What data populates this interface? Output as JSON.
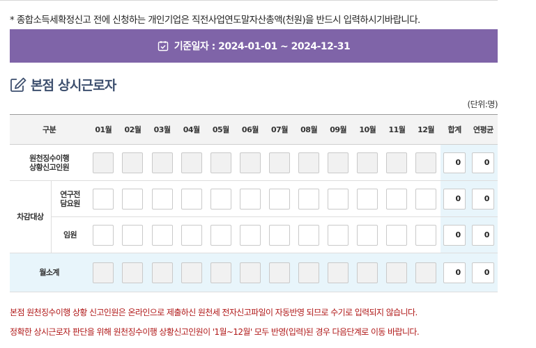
{
  "notice_top": "* 종합소득세확정신고 전에 신청하는 개인기업은 직전사업연도말자산총액(천원)을 반드시 입력하시기바랍니다.",
  "date_banner": "기준일자 : 2024-01-01 ~ 2024-12-31",
  "section_title": "본점 상시근로자",
  "unit_label": "(단위:명)",
  "table": {
    "header_category": "구분",
    "months": [
      "01월",
      "02월",
      "03월",
      "04월",
      "05월",
      "06월",
      "07월",
      "08월",
      "09월",
      "10월",
      "11월",
      "12월"
    ],
    "header_total": "합계",
    "header_avg": "연평균",
    "rows": {
      "withholding": {
        "label_line1": "원천징수이행",
        "label_line2": "상황신고인원",
        "total": "0",
        "avg": "0"
      },
      "deduction_group": "차감대상",
      "researcher": {
        "label_line1": "연구전",
        "label_line2": "담요원",
        "total": "0",
        "avg": "0"
      },
      "executive": {
        "label": "임원",
        "total": "0",
        "avg": "0"
      },
      "subtotal": {
        "label": "월소계",
        "total": "0",
        "avg": "0"
      }
    }
  },
  "warnings": [
    "본점 원천징수이행 상황 신고인원은 온라인으로 제출하신 원천세 전자신고파일이 자동반영 되므로 수기로 입력되지 않습니다.",
    "정확한 상시근로자 판단을 위해 원천징수이행 상황신고인원이 '1월~12월' 모두 반영(입력)된 경우 다음단계로 이동 바랍니다."
  ]
}
